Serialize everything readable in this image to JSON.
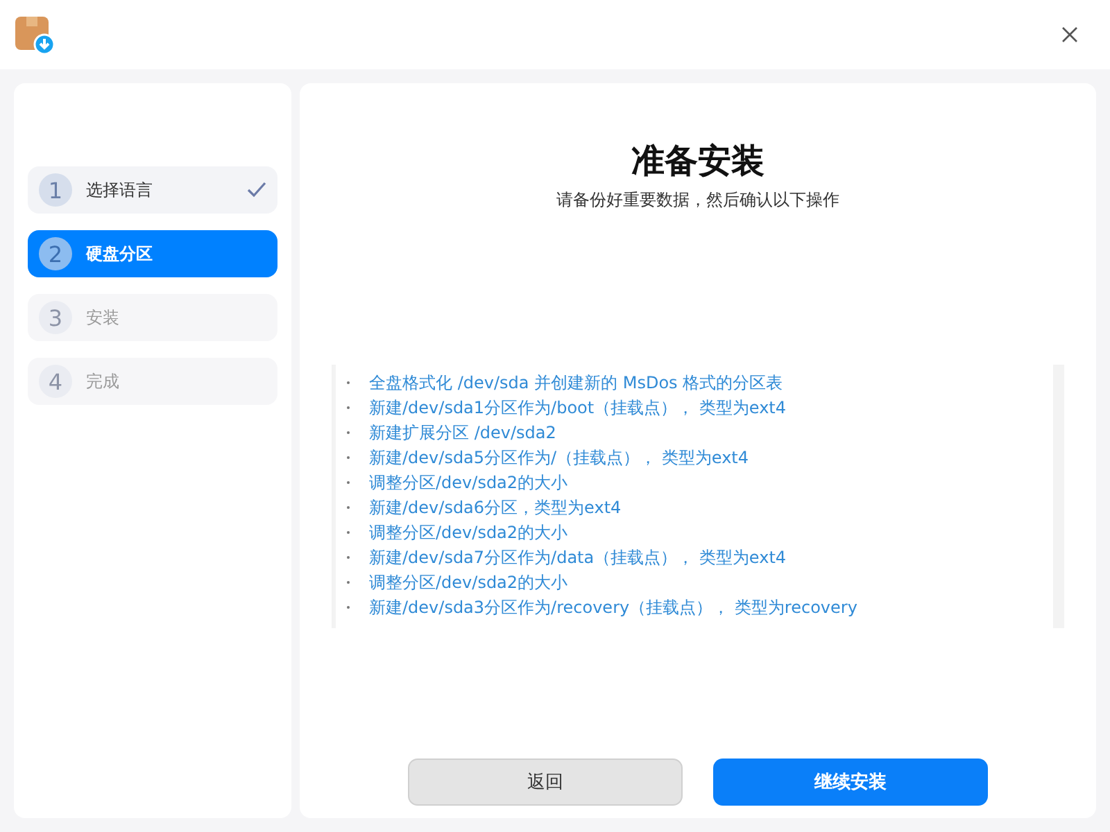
{
  "steps": [
    {
      "number": "1",
      "label": "选择语言",
      "done": true,
      "selected": false,
      "disabled": false
    },
    {
      "number": "2",
      "label": "硬盘分区",
      "done": false,
      "selected": true,
      "disabled": false
    },
    {
      "number": "3",
      "label": "安装",
      "done": false,
      "selected": false,
      "disabled": true
    },
    {
      "number": "4",
      "label": "完成",
      "done": false,
      "selected": false,
      "disabled": true
    }
  ],
  "main": {
    "title": "准备安装",
    "subtitle": "请备份好重要数据，然后确认以下操作",
    "operations": [
      "全盘格式化 /dev/sda 并创建新的 MsDos 格式的分区表",
      "新建/dev/sda1分区作为/boot（挂载点）， 类型为ext4",
      "新建扩展分区 /dev/sda2",
      "新建/dev/sda5分区作为/（挂载点）， 类型为ext4",
      "调整分区/dev/sda2的大小",
      "新建/dev/sda6分区，类型为ext4",
      "调整分区/dev/sda2的大小",
      "新建/dev/sda7分区作为/data（挂载点）， 类型为ext4",
      "调整分区/dev/sda2的大小",
      "新建/dev/sda3分区作为/recovery（挂载点）， 类型为recovery"
    ]
  },
  "buttons": [
    {
      "label": "返回",
      "kind": "secondary"
    },
    {
      "label": "继续安装",
      "kind": "primary"
    }
  ]
}
